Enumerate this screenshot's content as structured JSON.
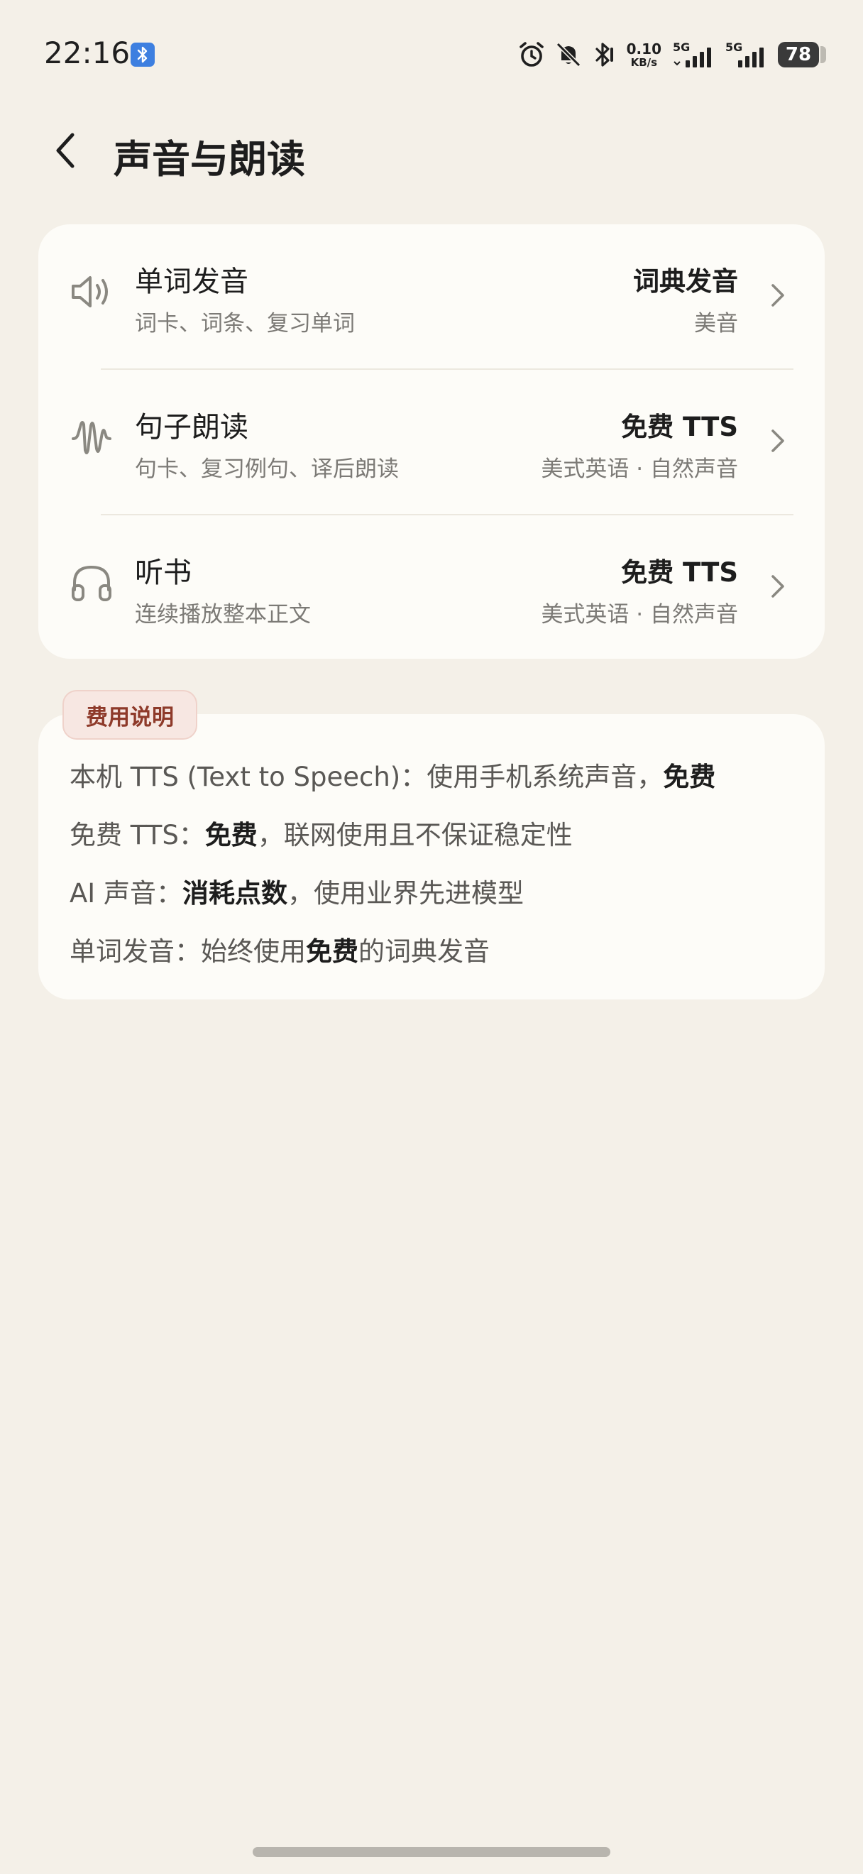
{
  "status_bar": {
    "time": "22:16",
    "net_speed_value": "0.10",
    "net_speed_unit": "KB/s",
    "sim1_label": "5G",
    "sim2_label": "5G",
    "battery": "78",
    "icons": [
      "bluetooth-icon",
      "alarm-icon",
      "mute-icon",
      "bluetooth-icon",
      "signal-icon",
      "battery-icon"
    ]
  },
  "header": {
    "title": "声音与朗读"
  },
  "settings": [
    {
      "icon": "speaker-icon",
      "title": "单词发音",
      "subtitle": "词卡、词条、复习单词",
      "value": "词典发音",
      "value_sub": "美音"
    },
    {
      "icon": "waveform-icon",
      "title": "句子朗读",
      "subtitle": "句卡、复习例句、译后朗读",
      "value": "免费 TTS",
      "value_sub": "美式英语 · 自然声音"
    },
    {
      "icon": "headphones-icon",
      "title": "听书",
      "subtitle": "连续播放整本正文",
      "value": "免费 TTS",
      "value_sub": "美式英语 · 自然声音"
    }
  ],
  "fee": {
    "badge": "费用说明",
    "lines": [
      {
        "prefix": "本机 TTS (Text to Speech)：使用手机系统声音，",
        "bold": "免费",
        "suffix": ""
      },
      {
        "prefix": "免费 TTS：",
        "bold": "免费",
        "suffix": "，联网使用且不保证稳定性"
      },
      {
        "prefix": "AI 声音：",
        "bold": "消耗点数",
        "suffix": "，使用业界先进模型"
      },
      {
        "prefix": "单词发音：始终使用",
        "bold": "免费",
        "suffix": "的词典发音"
      }
    ]
  },
  "colors": {
    "background": "#f4f0e8",
    "card": "#fdfcf8",
    "badge_bg": "#f7e7e2",
    "badge_text": "#8e3a2a",
    "bluetooth_badge": "#3d7fe0"
  }
}
